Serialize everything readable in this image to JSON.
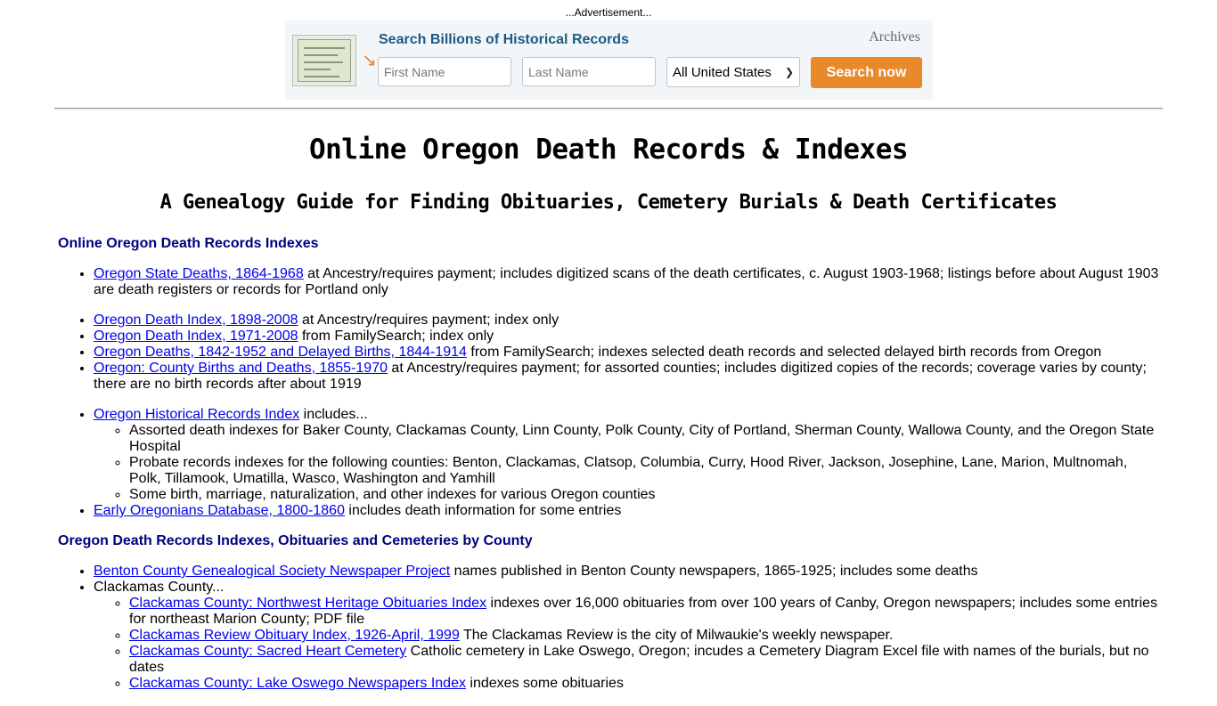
{
  "ad": {
    "label": "...Advertisement...",
    "title": "Search Billions of Historical Records",
    "brand": "Archives",
    "first_name_placeholder": "First Name",
    "last_name_placeholder": "Last Name",
    "location_selected": "All United States",
    "search_button": "Search now",
    "colors": {
      "title": "#1c5a84",
      "button": "#e8892a"
    }
  },
  "page": {
    "title": "Online Oregon Death Records & Indexes",
    "subtitle": "A Genealogy Guide for Finding Obituaries, Cemetery Burials & Death Certificates"
  },
  "section1": {
    "heading": "Online Oregon Death Records Indexes",
    "items": [
      {
        "link": "Oregon State Deaths, 1864-1968",
        "text": " at Ancestry/requires payment; includes digitized scans of the death certificates, c. August 1903-1968; listings before about August 1903 are death registers or records for Portland only"
      },
      {
        "link": "Oregon Death Index, 1898-2008",
        "text": " at Ancestry/requires payment; index only"
      },
      {
        "link": "Oregon Death Index, 1971-2008",
        "text": " from FamilySearch; index only"
      },
      {
        "link": "Oregon Deaths, 1842-1952 and Delayed Births, 1844-1914",
        "text": " from FamilySearch; indexes selected death records and selected delayed birth records from Oregon"
      },
      {
        "link": "Oregon: County Births and Deaths, 1855-1970",
        "text": " at Ancestry/requires payment; for assorted counties; includes digitized copies of the records; coverage varies by county; there are no birth records after about 1919"
      },
      {
        "link": "Oregon Historical Records Index",
        "text": " includes...",
        "subitems": [
          "Assorted death indexes for Baker County, Clackamas County, Linn County, Polk County, City of Portland, Sherman County, Wallowa County, and the Oregon State Hospital",
          "Probate records indexes for the following counties: Benton, Clackamas, Clatsop, Columbia, Curry, Hood River, Jackson, Josephine, Lane, Marion, Multnomah, Polk, Tillamook, Umatilla, Wasco, Washington and Yamhill",
          "Some birth, marriage, naturalization, and other indexes for various Oregon counties"
        ]
      },
      {
        "link": "Early Oregonians Database, 1800-1860",
        "text": " includes death information for some entries"
      }
    ]
  },
  "section2": {
    "heading": "Oregon Death Records Indexes, Obituaries and Cemeteries by County",
    "items": [
      {
        "link": "Benton County Genealogical Society Newspaper Project",
        "text": " names published in Benton County newspapers, 1865-1925; includes some deaths"
      },
      {
        "text": "Clackamas County...",
        "subitems": [
          {
            "link": "Clackamas County: Northwest Heritage Obituaries Index",
            "text": " indexes over 16,000 obituaries from over 100 years of Canby, Oregon newspapers; includes some entries for northeast Marion County; PDF file"
          },
          {
            "link": "Clackamas Review Obituary Index, 1926-April, 1999",
            "text": " The Clackamas Review is the city of Milwaukie's weekly newspaper."
          },
          {
            "link": "Clackamas County: Sacred Heart Cemetery",
            "text": " Catholic cemetery in Lake Oswego, Oregon; incudes a Cemetery Diagram Excel file with names of the burials, but no dates"
          },
          {
            "link": "Clackamas County: Lake Oswego Newspapers Index",
            "text": " indexes some obituaries"
          }
        ]
      }
    ]
  }
}
